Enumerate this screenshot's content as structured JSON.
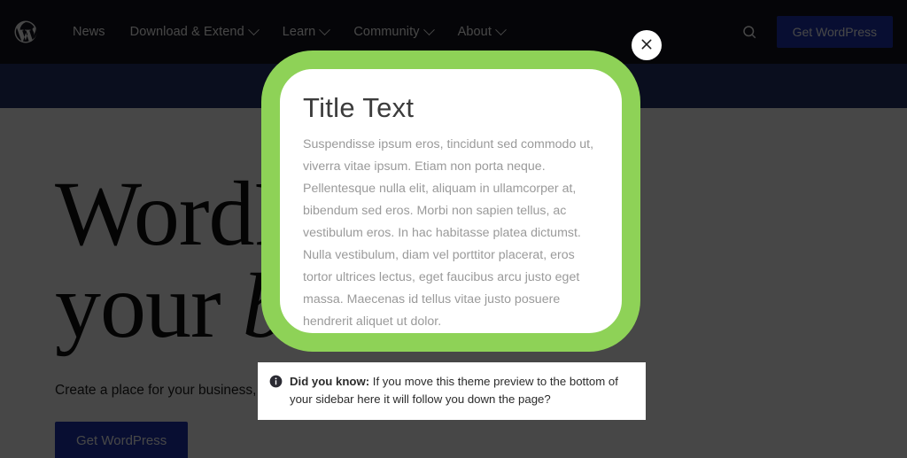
{
  "header": {
    "logo_icon": "wordpress-logo-icon",
    "nav": [
      {
        "label": "News",
        "has_dropdown": false
      },
      {
        "label": "Download & Extend",
        "has_dropdown": true
      },
      {
        "label": "Learn",
        "has_dropdown": true
      },
      {
        "label": "Community",
        "has_dropdown": true
      },
      {
        "label": "About",
        "has_dropdown": true
      }
    ],
    "search_icon": "search-icon",
    "cta_label": "Get WordPress"
  },
  "hero": {
    "title_line1": "WordPress for",
    "title_line2_plain": "your ",
    "title_line2_italic": "business",
    "subtitle": "Create a place for your business, your passion project, or a home on the web.",
    "cta_label": "Get WordPress"
  },
  "modal": {
    "title": "Title Text",
    "body": "Suspendisse ipsum eros, tincidunt sed commodo ut, viverra vitae ipsum. Etiam non porta neque. Pellentesque nulla elit, aliquam in ullamcorper at, bibendum sed eros. Morbi non sapien tellus, ac vestibulum eros. In hac habitasse platea dictumst. Nulla vestibulum, diam vel porttitor placerat, eros tortor ultrices lectus, eget faucibus arcu justo eget massa. Maecenas id tellus vitae justo posuere hendrerit aliquet ut dolor.",
    "border_color": "#8ed257",
    "close_icon": "close-x-icon"
  },
  "notice": {
    "icon": "info-circle-icon",
    "lead": "Did you know:",
    "text": " If you move this theme preview to the bottom of your sidebar here it will follow you down the page?"
  }
}
